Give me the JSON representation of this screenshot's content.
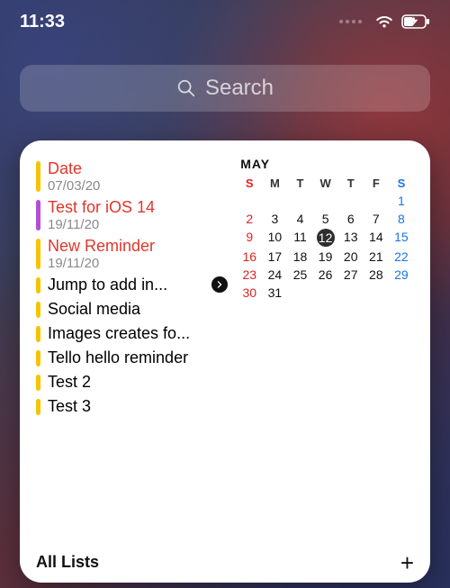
{
  "status": {
    "time": "11:33"
  },
  "search": {
    "placeholder": "Search"
  },
  "colors": {
    "yellow": "#f5c400",
    "purple": "#b24fd8",
    "overdue": "#e0362a"
  },
  "reminders": [
    {
      "title": "Date",
      "date": "07/03/20",
      "color": "yellow",
      "overdue": true,
      "chevron": false
    },
    {
      "title": "Test for iOS 14",
      "date": "19/11/20",
      "color": "purple",
      "overdue": true,
      "chevron": false
    },
    {
      "title": "New Reminder",
      "date": "19/11/20",
      "color": "yellow",
      "overdue": true,
      "chevron": false
    },
    {
      "title": "Jump to add in...",
      "date": null,
      "color": "yellow",
      "overdue": false,
      "chevron": true
    },
    {
      "title": "Social media",
      "date": null,
      "color": "yellow",
      "overdue": false,
      "chevron": false
    },
    {
      "title": "Images creates fo...",
      "date": null,
      "color": "yellow",
      "overdue": false,
      "chevron": false
    },
    {
      "title": "Tello hello reminder",
      "date": null,
      "color": "yellow",
      "overdue": false,
      "chevron": false
    },
    {
      "title": "Test 2",
      "date": null,
      "color": "yellow",
      "overdue": false,
      "chevron": false
    },
    {
      "title": "Test 3",
      "date": null,
      "color": "yellow",
      "overdue": false,
      "chevron": false
    }
  ],
  "calendar": {
    "month_label": "MAY",
    "weekdays": [
      "S",
      "M",
      "T",
      "W",
      "T",
      "F",
      "S"
    ],
    "first_day_index": 6,
    "days_in_month": 31,
    "today": 12
  },
  "footer": {
    "title": "All Lists"
  }
}
